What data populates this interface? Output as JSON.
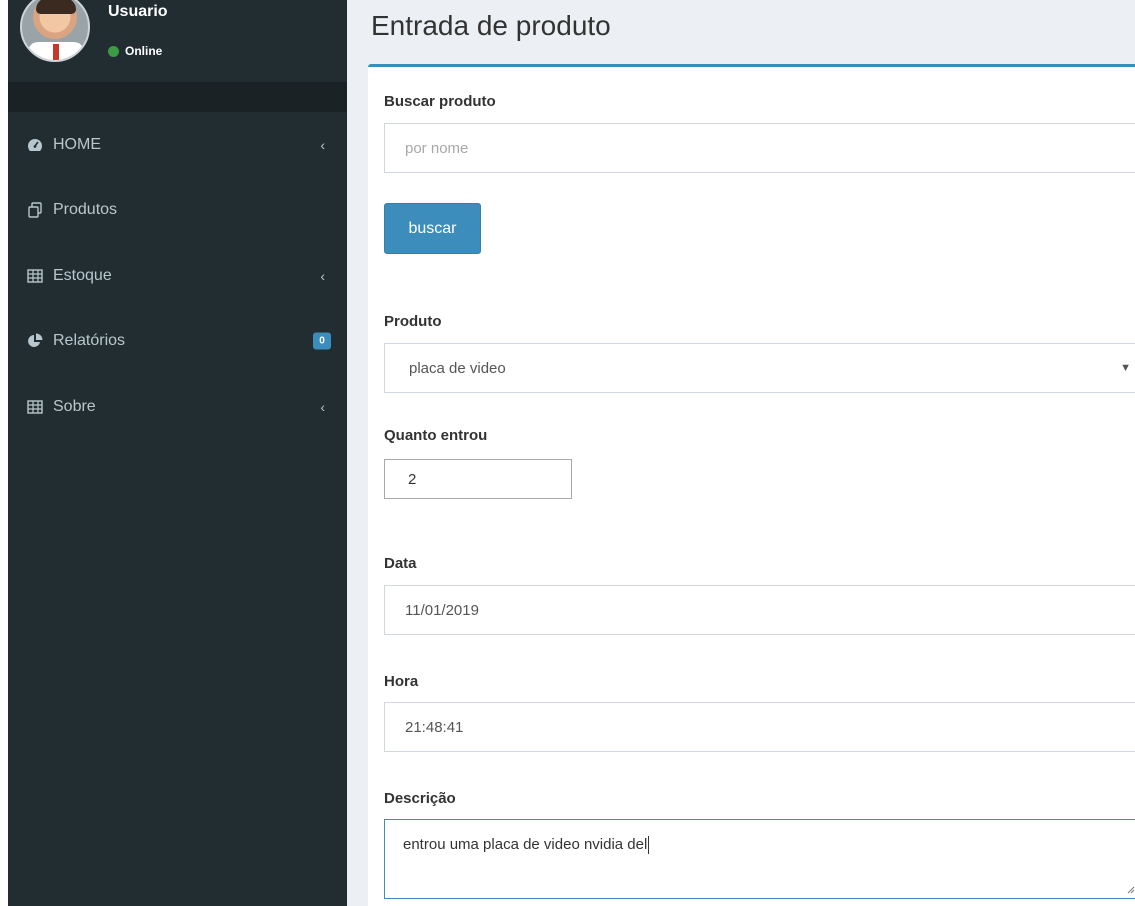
{
  "user": {
    "name": "Usuario",
    "status": "Online",
    "status_color": "#3c9a45"
  },
  "menu": [
    {
      "label": "HOME",
      "icon": "dashboard-icon",
      "chevron": true
    },
    {
      "label": "Produtos",
      "icon": "copy-icon",
      "chevron": false
    },
    {
      "label": "Estoque",
      "icon": "table-icon",
      "chevron": true
    },
    {
      "label": "Relatórios",
      "icon": "pie-chart-icon",
      "badge": "0"
    },
    {
      "label": "Sobre",
      "icon": "table-icon",
      "chevron": true
    }
  ],
  "page": {
    "title": "Entrada de produto"
  },
  "form": {
    "search_label": "Buscar produto",
    "search_placeholder": "por nome",
    "search_button": "buscar",
    "product_label": "Produto",
    "product_value": "placa de video",
    "quantity_label": "Quanto entrou",
    "quantity_value": "2",
    "date_label": "Data",
    "date_value": "11/01/2019",
    "time_label": "Hora",
    "time_value": "21:48:41",
    "description_label": "Descrição",
    "description_value": "entrou uma placa de video nvidia del"
  },
  "colors": {
    "sidebar": "#222d32",
    "accent": "#3c8dbc",
    "content_bg": "#ecf0f5"
  }
}
